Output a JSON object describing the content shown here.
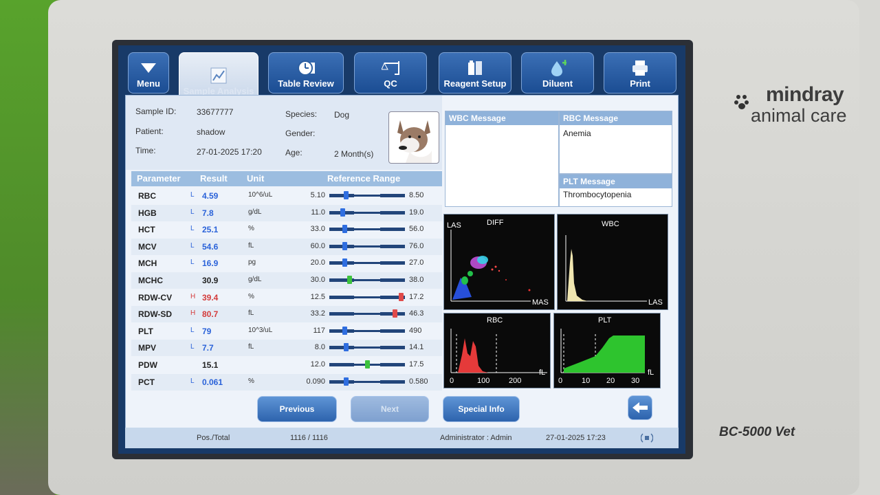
{
  "brand": {
    "line1": "mindray",
    "line2": "animal care",
    "model": "BC-5000 Vet"
  },
  "nav": [
    {
      "label": "Menu",
      "icon": "down-triangle-icon"
    },
    {
      "label": "Sample Analysis",
      "icon": "chart-icon"
    },
    {
      "label": "Table Review",
      "icon": "clock-icon"
    },
    {
      "label": "QC",
      "icon": "scale-icon"
    },
    {
      "label": "Reagent Setup",
      "icon": "reagent-icon"
    },
    {
      "label": "Diluent",
      "icon": "drop-icon"
    },
    {
      "label": "Print",
      "icon": "printer-icon"
    }
  ],
  "sample": {
    "id_label": "Sample ID:",
    "id": "33677777",
    "patient_label": "Patient:",
    "patient": "shadow",
    "time_label": "Time:",
    "time": "27-01-2025 17:20",
    "species_label": "Species:",
    "species": "Dog",
    "gender_label": "Gender:",
    "gender": "",
    "age_label": "Age:",
    "age": "2 Month(s)"
  },
  "table": {
    "headers": {
      "parameter": "Parameter",
      "result": "Result",
      "unit": "Unit",
      "range": "Reference Range"
    },
    "rows": [
      {
        "name": "RBC",
        "flag": "L",
        "result": "4.59",
        "unit": "10^6/uL",
        "lo": "5.10",
        "hi": "8.50",
        "level": 0.2,
        "status": "low"
      },
      {
        "name": "HGB",
        "flag": "L",
        "result": "7.8",
        "unit": "g/dL",
        "lo": "11.0",
        "hi": "19.0",
        "level": 0.15,
        "status": "low"
      },
      {
        "name": "HCT",
        "flag": "L",
        "result": "25.1",
        "unit": "%",
        "lo": "33.0",
        "hi": "56.0",
        "level": 0.18,
        "status": "low"
      },
      {
        "name": "MCV",
        "flag": "L",
        "result": "54.6",
        "unit": "fL",
        "lo": "60.0",
        "hi": "76.0",
        "level": 0.18,
        "status": "low"
      },
      {
        "name": "MCH",
        "flag": "L",
        "result": "16.9",
        "unit": "pg",
        "lo": "20.0",
        "hi": "27.0",
        "level": 0.18,
        "status": "low"
      },
      {
        "name": "MCHC",
        "flag": "",
        "result": "30.9",
        "unit": "g/dL",
        "lo": "30.0",
        "hi": "38.0",
        "level": 0.25,
        "status": "normal"
      },
      {
        "name": "RDW-CV",
        "flag": "H",
        "result": "39.4",
        "unit": "%",
        "lo": "12.5",
        "hi": "17.2",
        "level": 0.97,
        "status": "high"
      },
      {
        "name": "RDW-SD",
        "flag": "H",
        "result": "80.7",
        "unit": "fL",
        "lo": "33.2",
        "hi": "46.3",
        "level": 0.88,
        "status": "high"
      },
      {
        "name": "PLT",
        "flag": "L",
        "result": "79",
        "unit": "10^3/uL",
        "lo": "117",
        "hi": "490",
        "level": 0.18,
        "status": "low"
      },
      {
        "name": "MPV",
        "flag": "L",
        "result": "7.7",
        "unit": "fL",
        "lo": "8.0",
        "hi": "14.1",
        "level": 0.2,
        "status": "low"
      },
      {
        "name": "PDW",
        "flag": "",
        "result": "15.1",
        "unit": "",
        "lo": "12.0",
        "hi": "17.5",
        "level": 0.5,
        "status": "normal"
      },
      {
        "name": "PCT",
        "flag": "L",
        "result": "0.061",
        "unit": "%",
        "lo": "0.090",
        "hi": "0.580",
        "level": 0.2,
        "status": "low"
      }
    ]
  },
  "messages": {
    "wbc_title": "WBC Message",
    "wbc_text": "",
    "rbc_title": "RBC Message",
    "rbc_text": "Anemia",
    "plt_title": "PLT Message",
    "plt_text": "Thrombocytopenia"
  },
  "plots": {
    "diff": {
      "title": "DIFF",
      "y": "LAS",
      "x": "MAS"
    },
    "wbc": {
      "title": "WBC",
      "x": "LAS"
    },
    "rbc": {
      "title": "RBC",
      "unit": "fL",
      "ticks": [
        "0",
        "100",
        "200"
      ]
    },
    "plt": {
      "title": "PLT",
      "unit": "fL",
      "ticks": [
        "0",
        "10",
        "20",
        "30"
      ]
    }
  },
  "buttons": {
    "previous": "Previous",
    "next": "Next",
    "special": "Special Info"
  },
  "status": {
    "pos_label": "Pos./Total",
    "pos_value": "1116 / 1116",
    "user": "Administrator : Admin",
    "datetime": "27-01-2025 17:23"
  },
  "colors": {
    "low": "#2a62d9",
    "high": "#d43b3b",
    "normal": "#222222",
    "marker_low": "#2f6ee0",
    "marker_high": "#e04a4a",
    "marker_normal": "#3dc23d"
  }
}
